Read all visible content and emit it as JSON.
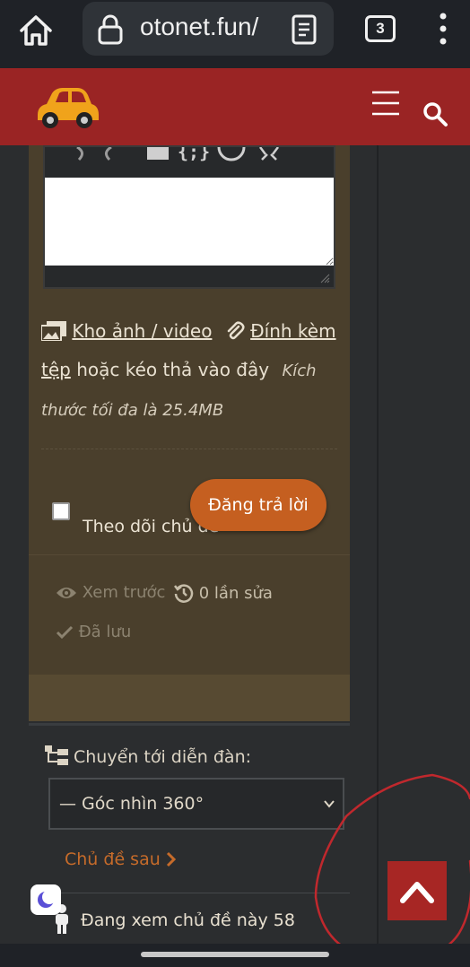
{
  "browser": {
    "url": "otonet.fun/",
    "tab_count": "3"
  },
  "editor": {
    "media_link": "Kho ảnh / video",
    "attach_link_1": "Đính kèm",
    "attach_link_2": "tệp",
    "drag_text": "hoặc kéo thả vào đây",
    "size_note": "Kích thước tối đa là 25.4MB",
    "follow_label": "Theo dõi chủ đề",
    "submit_label": "Đăng trả lời",
    "preview_label": "Xem trước",
    "edits_label": "0 lần sửa",
    "saved_label": "Đã lưu"
  },
  "forum_nav": {
    "jump_label": "Chuyển tới diễn đàn:",
    "selected_forum": "— Góc nhìn 360°",
    "next_topic": "Chủ đề sau",
    "viewing_text": "Đang xem chủ đề này 58"
  },
  "colors": {
    "header_red": "#9a2424",
    "accent_orange": "#c55f20",
    "panel_brown": "#4a3f2c",
    "backtop_red": "#a72624"
  }
}
